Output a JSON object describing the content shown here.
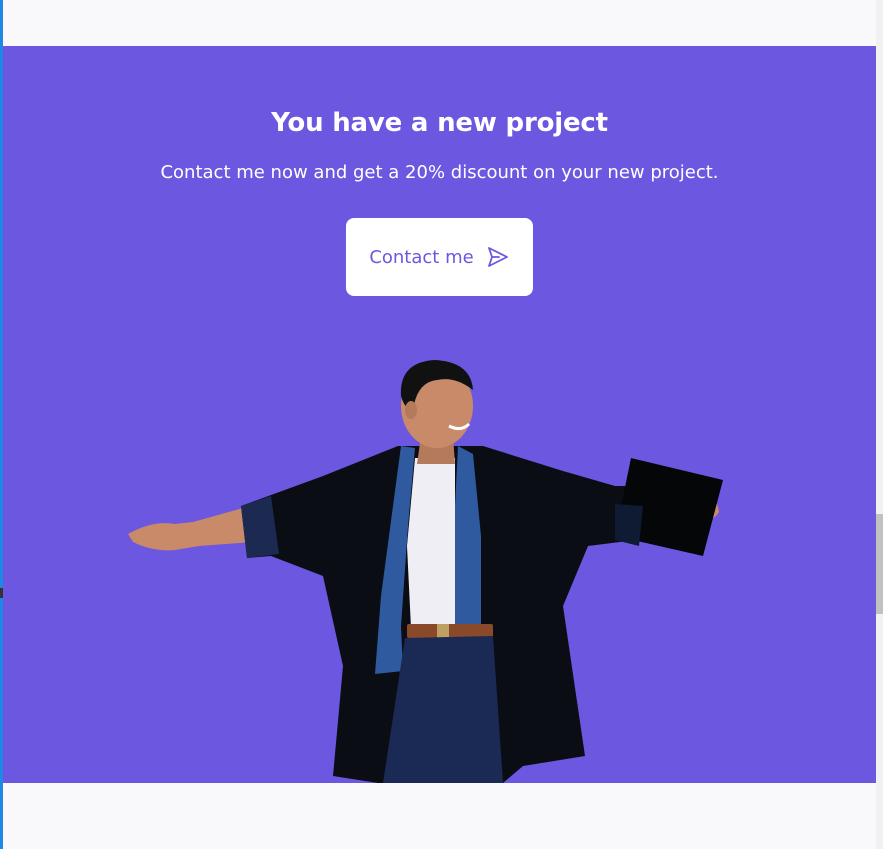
{
  "banner": {
    "title": "You have a new project",
    "subtitle": "Contact me now and get a 20% discount on your new project.",
    "cta": {
      "label": "Contact me",
      "icon": "send-icon"
    },
    "image": {
      "subject": "graduate-photo"
    }
  },
  "colors": {
    "accent": "#6c57e0",
    "button_bg": "#ffffff",
    "page_bg": "#f9f9fb"
  }
}
